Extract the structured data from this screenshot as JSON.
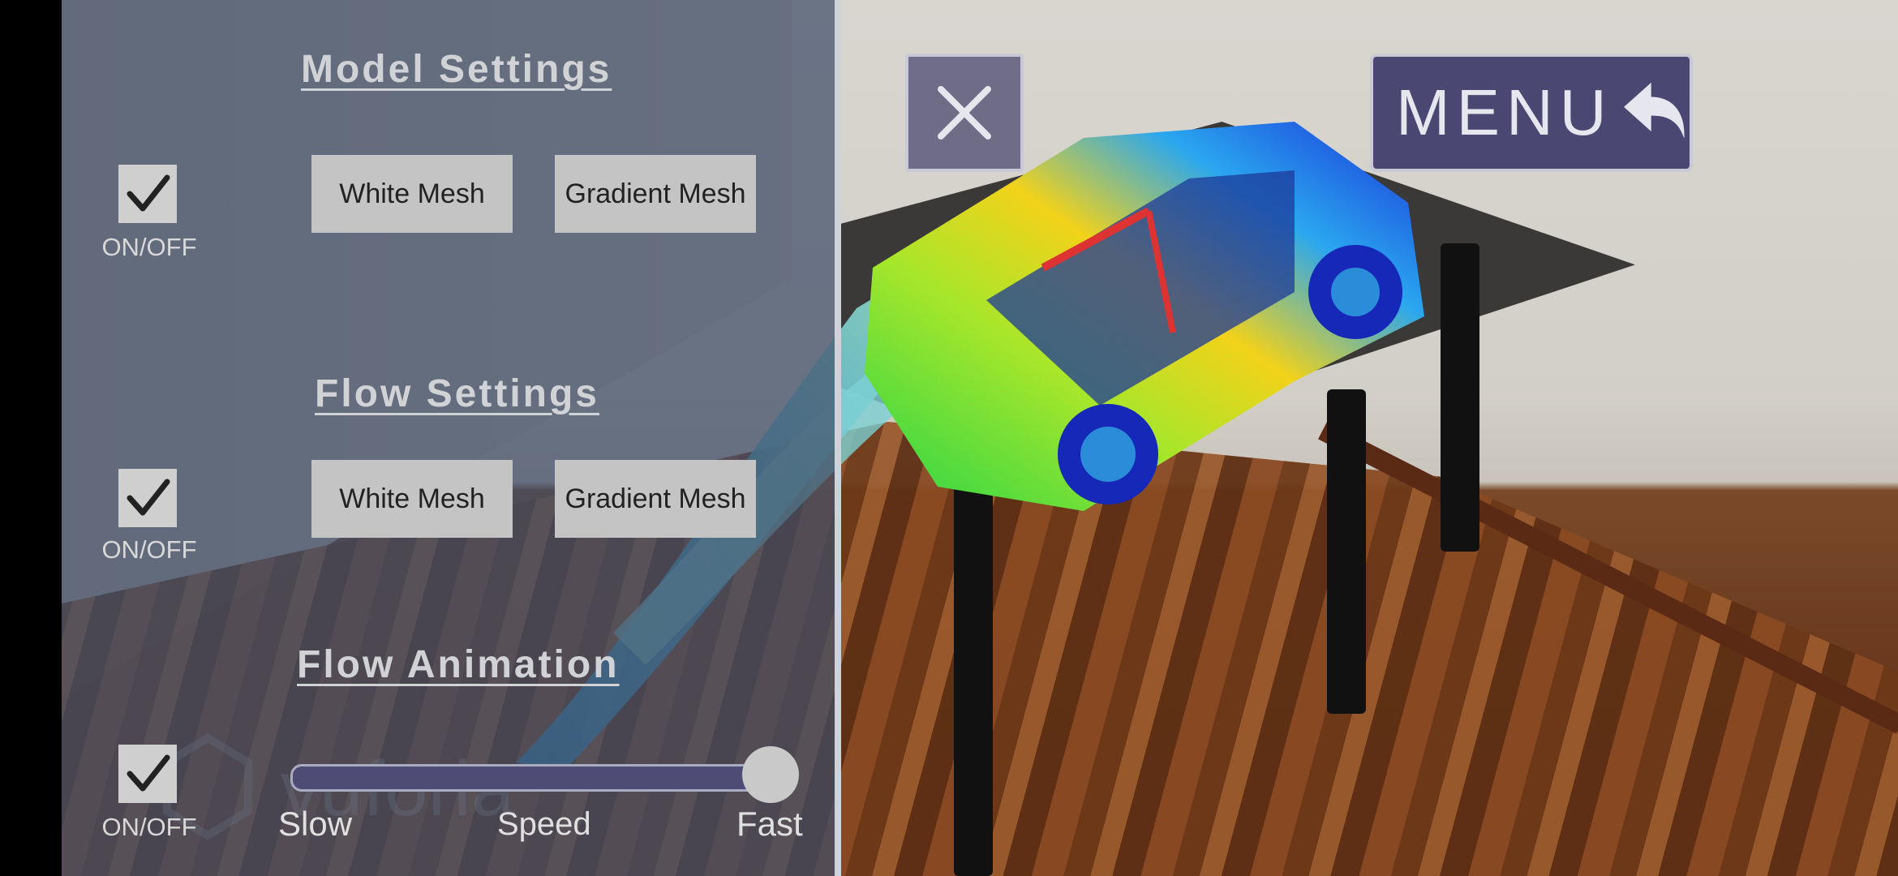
{
  "model_settings": {
    "title": "Model Settings",
    "toggle_label": "ON/OFF",
    "toggle_checked": true,
    "white_mesh_label": "White Mesh",
    "gradient_mesh_label": "Gradient Mesh"
  },
  "flow_settings": {
    "title": "Flow Settings",
    "toggle_label": "ON/OFF",
    "toggle_checked": true,
    "white_mesh_label": "White Mesh",
    "gradient_mesh_label": "Gradient Mesh"
  },
  "flow_animation": {
    "title": "Flow Animation",
    "toggle_label": "ON/OFF",
    "toggle_checked": true,
    "speed_label": "Speed",
    "slow_label": "Slow",
    "fast_label": "Fast",
    "speed_value_fraction": 1.0
  },
  "overlay": {
    "menu_label": "MENU",
    "close_icon": "close-icon",
    "back_icon": "undo-arrow-icon"
  },
  "watermark": {
    "text": "vuforia"
  },
  "colors": {
    "panel_bg": "#404e68",
    "button_bg": "#c4c4c4",
    "accent_purple": "#4a4773",
    "slider_track": "#4e4b74"
  }
}
